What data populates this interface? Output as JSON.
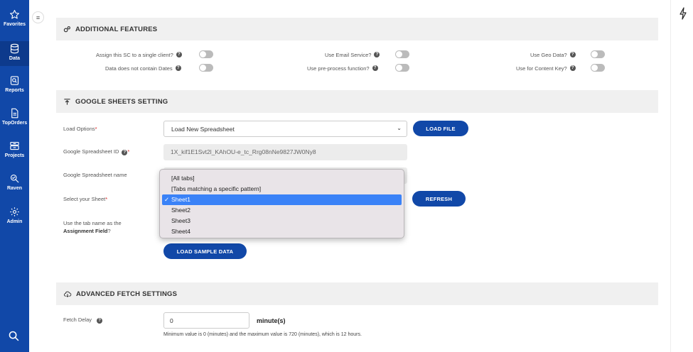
{
  "sidebar": {
    "items": [
      {
        "label": "Favorites",
        "icon": "star-icon"
      },
      {
        "label": "Data",
        "icon": "database-icon"
      },
      {
        "label": "Reports",
        "icon": "reports-icon"
      },
      {
        "label": "TopOrders",
        "icon": "document-icon"
      },
      {
        "label": "Projects",
        "icon": "projects-icon"
      },
      {
        "label": "Raven",
        "icon": "raven-icon"
      },
      {
        "label": "Admin",
        "icon": "gear-icon"
      }
    ],
    "search_icon": "search-icon",
    "collapse_icon": "≡"
  },
  "colors": {
    "primary": "#1148a8",
    "section_bg": "#f0f0f0",
    "selected": "#3a82f7"
  },
  "additional_features": {
    "title": "ADDITIONAL FEATURES",
    "toggles": [
      {
        "label": "Assign this SC to a single client?",
        "on": false
      },
      {
        "label": "Data does not contain Dates",
        "on": false
      },
      {
        "label": "Use Email Service?",
        "on": false
      },
      {
        "label": "Use pre-process function?",
        "on": false
      },
      {
        "label": "Use Geo Data?",
        "on": false
      },
      {
        "label": "Use for Content Key?",
        "on": false
      }
    ]
  },
  "google_sheets": {
    "title": "GOOGLE SHEETS SETTING",
    "load_options_label": "Load Options",
    "load_options_value": "Load New Spreadsheet",
    "load_file_button": "LOAD FILE",
    "spreadsheet_id_label": "Google Spreadsheet ID",
    "spreadsheet_id_value": "1X_kif1E1Svt2l_KAhOU-e_tc_Rrg08nNe9827JW0Ny8",
    "spreadsheet_name_label": "Google Spreadsheet name",
    "select_sheet_label": "Select your Sheet",
    "refresh_button": "REFRESH",
    "tab_name_label_1": "Use the tab name as the",
    "tab_name_label_2": "Assignment Field",
    "load_sample_button": "LOAD SAMPLE DATA",
    "sheet_options": [
      "[All tabs]",
      "[Tabs matching a specific pattern]",
      "Sheet1",
      "Sheet2",
      "Sheet3",
      "Sheet4"
    ],
    "selected_sheet": "Sheet1",
    "required_marker": "*",
    "question_marker": "?"
  },
  "advanced_fetch": {
    "title": "ADVANCED FETCH SETTINGS",
    "fetch_delay_label": "Fetch Delay",
    "fetch_delay_value": "0",
    "unit": "minute(s)",
    "hint": "Minimum value is 0 (minutes) and the maximum value is 720 (minutes), which is 12 hours."
  }
}
